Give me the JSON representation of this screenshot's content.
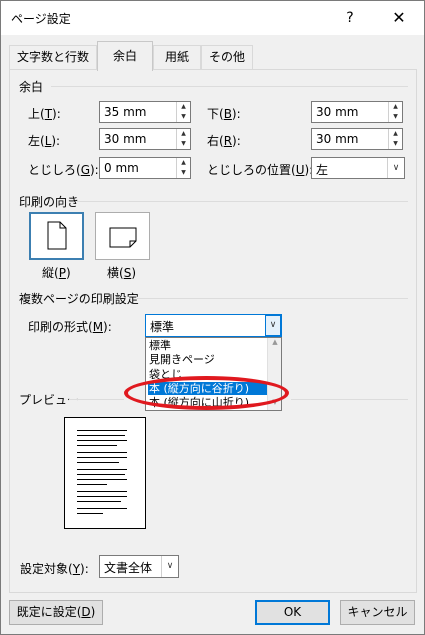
{
  "window": {
    "title": "ページ設定",
    "help": "?",
    "close": "✕"
  },
  "tabs": [
    "文字数と行数",
    "余白",
    "用紙",
    "その他"
  ],
  "margins": {
    "group_title": "余白",
    "top_label": "上(",
    "top_key": "T",
    "top_suffix": "):",
    "top_value": "35 mm",
    "bottom_label": "下(",
    "bottom_key": "B",
    "bottom_suffix": "):",
    "bottom_value": "30 mm",
    "left_label": "左(",
    "left_key": "L",
    "left_suffix": "):",
    "left_value": "30 mm",
    "right_label": "右(",
    "right_key": "R",
    "right_suffix": "):",
    "right_value": "30 mm",
    "gutter_label": "とじしろ(",
    "gutter_key": "G",
    "gutter_suffix": "):",
    "gutter_value": "0 mm",
    "gutter_pos_label": "とじしろの位置(",
    "gutter_pos_key": "U",
    "gutter_pos_suffix": "):",
    "gutter_pos_value": "左"
  },
  "orientation": {
    "group_title": "印刷の向き",
    "portrait_label": "縦(",
    "portrait_key": "P",
    "portrait_suffix": ")",
    "landscape_label": "横(",
    "landscape_key": "S",
    "landscape_suffix": ")"
  },
  "pages": {
    "group_title": "複数ページの印刷設定",
    "format_label": "印刷の形式(",
    "format_key": "M",
    "format_suffix": "):",
    "format_value": "標準",
    "options": [
      "標準",
      "見開きページ",
      "袋とじ",
      "本 (縦方向に谷折り)",
      "本 (縦方向に山折り)"
    ],
    "selected_index": 3
  },
  "preview": {
    "group_title": "プレビュー"
  },
  "apply": {
    "label": "設定対象(",
    "key": "Y",
    "suffix": "):",
    "value": "文書全体"
  },
  "buttons": {
    "default_label": "既定に設定(",
    "default_key": "D",
    "default_suffix": ")",
    "ok": "OK",
    "cancel": "キャンセル"
  },
  "colors": {
    "selection": "#0078d7",
    "annotation": "#e0191f",
    "focus": "#3c7fb1"
  }
}
